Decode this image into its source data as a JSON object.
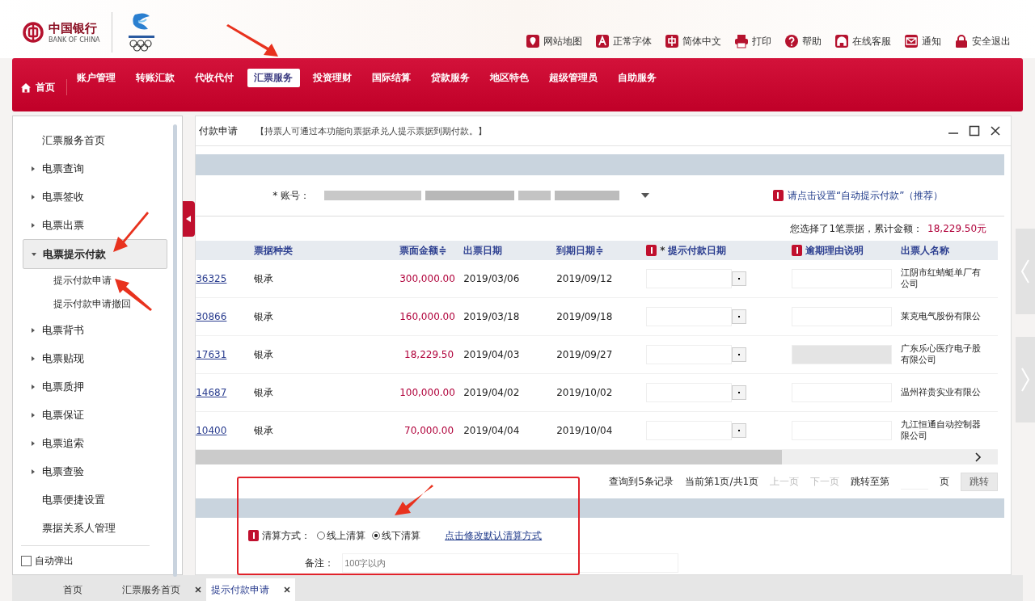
{
  "header": {
    "bank_name": "中国银行",
    "bank_name_en": "BANK OF CHINA",
    "links": [
      {
        "label": "网站地图"
      },
      {
        "label": "正常字体"
      },
      {
        "label": "简体中文"
      },
      {
        "label": "打印"
      },
      {
        "label": "帮助"
      },
      {
        "label": "在线客服"
      },
      {
        "label": "通知"
      },
      {
        "label": "安全退出"
      }
    ]
  },
  "nav": [
    {
      "label": "首页",
      "kind": "home",
      "selected": false
    },
    {
      "label": "账户管理",
      "kind": "tab",
      "selected": false
    },
    {
      "label": "转账汇款",
      "kind": "tab",
      "selected": false
    },
    {
      "label": "代收代付",
      "kind": "tab",
      "selected": false
    },
    {
      "label": "汇票服务",
      "kind": "tab",
      "selected": true
    },
    {
      "label": "投资理财",
      "kind": "tab",
      "selected": false
    },
    {
      "label": "国际结算",
      "kind": "tab",
      "selected": false
    },
    {
      "label": "贷款服务",
      "kind": "tab",
      "selected": false
    },
    {
      "label": "地区特色",
      "kind": "tab",
      "selected": false
    },
    {
      "label": "超级管理员",
      "kind": "tab",
      "selected": false
    },
    {
      "label": "自助服务",
      "kind": "tab",
      "selected": false
    }
  ],
  "sidebar": {
    "items": [
      {
        "label": "汇票服务首页",
        "kind": "link",
        "selected": false
      },
      {
        "label": "电票查询",
        "kind": "group",
        "expanded": false,
        "selected": false
      },
      {
        "label": "电票签收",
        "kind": "group",
        "expanded": false,
        "selected": false
      },
      {
        "label": "电票出票",
        "kind": "group",
        "expanded": false,
        "selected": false
      },
      {
        "label": "电票提示付款",
        "kind": "group",
        "expanded": true,
        "selected": true,
        "children": [
          {
            "label": "提示付款申请"
          },
          {
            "label": "提示付款申请撤回"
          }
        ]
      },
      {
        "label": "电票背书",
        "kind": "group",
        "expanded": false,
        "selected": false
      },
      {
        "label": "电票贴现",
        "kind": "group",
        "expanded": false,
        "selected": false
      },
      {
        "label": "电票质押",
        "kind": "group",
        "expanded": false,
        "selected": false
      },
      {
        "label": "电票保证",
        "kind": "group",
        "expanded": false,
        "selected": false
      },
      {
        "label": "电票追索",
        "kind": "group",
        "expanded": false,
        "selected": false
      },
      {
        "label": "电票查验",
        "kind": "group",
        "expanded": false,
        "selected": false
      },
      {
        "label": "电票便捷设置",
        "kind": "link",
        "selected": false
      },
      {
        "label": "票据关系人管理",
        "kind": "link",
        "selected": false
      }
    ],
    "auto_popup": {
      "label": "自动弹出",
      "checked": false
    }
  },
  "panel": {
    "title": "付款申请",
    "notice": "【持票人可通过本功能向票据承兑人提示票据到期付款。】",
    "account_mark": "*",
    "account_label": "账号：",
    "required_column_mark": "*",
    "auto_link": "请点击设置“自动提示付款”（推荐）",
    "summary": "您选择了1笔票据，累计金额：",
    "summary_amount": "18,229.50元",
    "columns": [
      "票据种类",
      "票面金额≑",
      "出票日期",
      "到期日期≑",
      "提示付款日期",
      "逾期理由说明",
      "出票人名称"
    ],
    "rows": [
      {
        "number": "36325",
        "type": "银承",
        "amount": "300,000.00",
        "issue_date": "2019/03/06",
        "due_date": "2019/09/12",
        "reason_disabled": false,
        "drawer": [
          "江阴市红蜻蜓单厂有",
          "公司"
        ]
      },
      {
        "number": "30866",
        "type": "银承",
        "amount": "160,000.00",
        "issue_date": "2019/03/18",
        "due_date": "2019/09/18",
        "reason_disabled": false,
        "drawer": [
          "莱克电气股份有限公"
        ]
      },
      {
        "number": "17631",
        "type": "银承",
        "amount": "18,229.50",
        "issue_date": "2019/04/03",
        "due_date": "2019/09/27",
        "reason_disabled": true,
        "drawer": [
          "广东乐心医疗电子股",
          "有限公司"
        ]
      },
      {
        "number": "14687",
        "type": "银承",
        "amount": "100,000.00",
        "issue_date": "2019/04/02",
        "due_date": "2019/10/02",
        "reason_disabled": false,
        "drawer": [
          "温州祥贵实业有限公"
        ]
      },
      {
        "number": "10400",
        "type": "银承",
        "amount": "70,000.00",
        "issue_date": "2019/04/04",
        "due_date": "2019/10/04",
        "reason_disabled": false,
        "drawer": [
          "九江恒通自动控制器",
          "限公司"
        ]
      }
    ],
    "pagination": {
      "records": "查询到5条记录",
      "page": "当前第1页/共1页",
      "prev": "上一页",
      "next": "下一页",
      "jump_label": "跳转至第",
      "page_unit": "页",
      "jump_button": "跳转"
    },
    "settlement": {
      "label": "清算方式：",
      "options": [
        {
          "label": "线上清算",
          "selected": false
        },
        {
          "label": "线下清算",
          "selected": true
        }
      ],
      "link": "点击修改默认清算方式"
    },
    "remarks": {
      "label": "备注：",
      "placeholder": "100字以内"
    }
  },
  "bottom_tabs": [
    {
      "label": "首页",
      "closable": false,
      "selected": false
    },
    {
      "label": "汇票服务首页",
      "closable": true,
      "selected": false
    },
    {
      "label": "提示付款申请",
      "closable": true,
      "selected": true
    }
  ]
}
